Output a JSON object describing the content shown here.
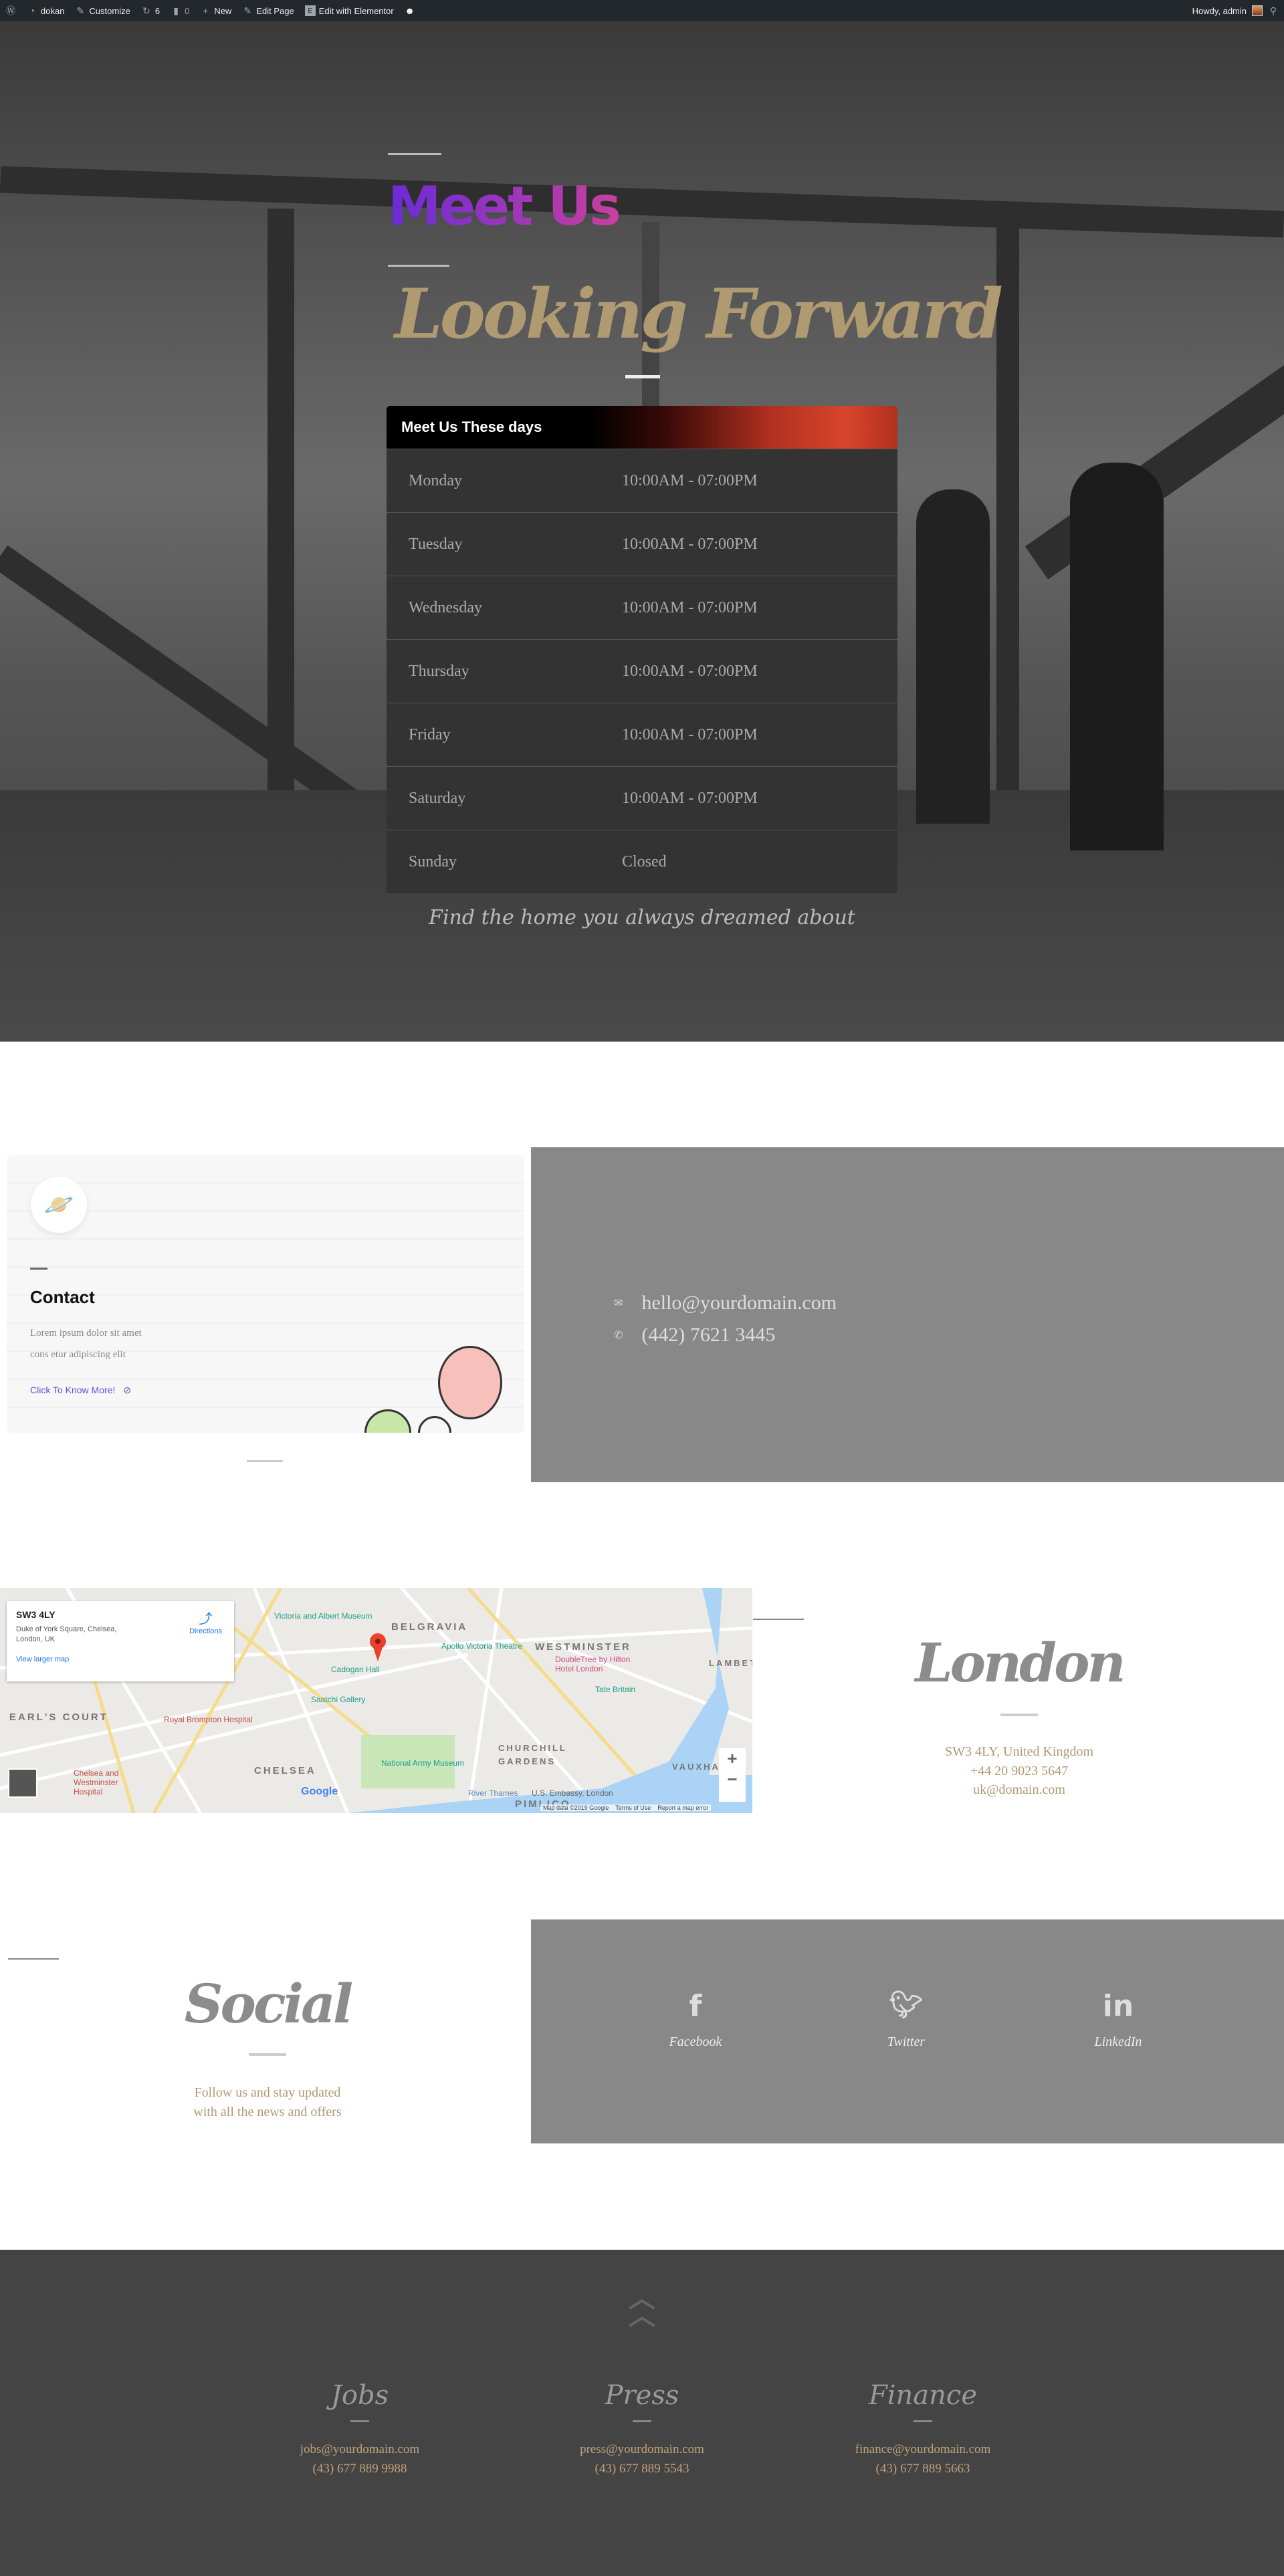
{
  "admin_bar": {
    "site": "dokan",
    "customize": "Customize",
    "updates": "6",
    "comments": "0",
    "new": "New",
    "edit_page": "Edit Page",
    "edit_elementor": "Edit with Elementor",
    "greeting": "Howdy, admin"
  },
  "hero": {
    "kicker": "Meet Us",
    "title": "Looking Forward",
    "table_title": "Meet Us These days",
    "hours": [
      {
        "day": "Monday",
        "time": "10:00AM - 07:00PM"
      },
      {
        "day": "Tuesday",
        "time": "10:00AM - 07:00PM"
      },
      {
        "day": "Wednesday",
        "time": "10:00AM - 07:00PM"
      },
      {
        "day": "Thursday",
        "time": "10:00AM - 07:00PM"
      },
      {
        "day": "Friday",
        "time": "10:00AM - 07:00PM"
      },
      {
        "day": "Saturday",
        "time": "10:00AM - 07:00PM"
      },
      {
        "day": "Sunday",
        "time": "Closed"
      }
    ],
    "tagline": "Find the home you always dreamed about"
  },
  "contact": {
    "title": "Contact",
    "text1": "Lorem ipsum dolor sit amet",
    "text2": "cons etur adipiscing elit",
    "link": "Click To Know More!",
    "email": "hello@yourdomain.com",
    "phone": "(442) 7621 3445"
  },
  "map": {
    "place": "SW3 4LY",
    "address1": "Duke of York Square, Chelsea,",
    "address2": "London, UK",
    "directions": "Directions",
    "larger": "View larger map",
    "attribution": "Map data ©2019 Google",
    "terms": "Terms of Use",
    "report": "Report a map error",
    "google": "Google",
    "labels": [
      "BELGRAVIA",
      "WESTMINSTER",
      "PIMLICO",
      "CHELSEA",
      "EARL'S COURT",
      "CHURCHILL GARDENS",
      "LAMBETH",
      "VAUXHALL"
    ],
    "places": [
      "Victoria and Albert Museum",
      "Apollo Victoria Theatre",
      "Cadogan Hall",
      "Saatchi Gallery",
      "Royal Brompton Hospital",
      "National Army Museum",
      "Tate Britain",
      "DoubleTree by Hilton Hotel London",
      "Chelsea and Westminster Hospital",
      "U.S. Embassy, London",
      "River Thames"
    ]
  },
  "london": {
    "title": "London",
    "address": "SW3 4LY, United Kingdom",
    "phone": "+44 20 9023 5647",
    "email": "uk@domain.com"
  },
  "social": {
    "title": "Social",
    "text1": "Follow us and stay updated",
    "text2": "with all the news and offers",
    "items": [
      {
        "icon": "facebook-icon",
        "label": "Facebook"
      },
      {
        "icon": "twitter-icon",
        "label": "Twitter"
      },
      {
        "icon": "linkedin-icon",
        "label": "LinkedIn"
      }
    ]
  },
  "footer": {
    "cols": [
      {
        "title": "Jobs",
        "email": "jobs@yourdomain.com",
        "phone": "(43) 677 889 9988"
      },
      {
        "title": "Press",
        "email": "press@yourdomain.com",
        "phone": "(43) 677 889 5543"
      },
      {
        "title": "Finance",
        "email": "finance@yourdomain.com",
        "phone": "(43) 677 889 5663"
      }
    ]
  },
  "colors": {
    "gold": "#b09a72",
    "purple": "#6b2bd6",
    "pink": "#c8409e",
    "footer_bg": "#444444",
    "panel_gray": "#888888"
  }
}
